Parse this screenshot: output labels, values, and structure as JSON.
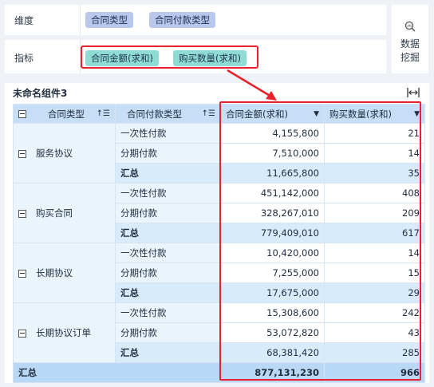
{
  "fields": {
    "dimension_label": "维度",
    "dimension_pills": [
      "合同类型",
      "合同付款类型"
    ],
    "measure_label": "指标",
    "measure_pills": [
      "合同金额(求和)",
      "购买数量(求和)"
    ]
  },
  "mining": {
    "line1": "数据",
    "line2": "挖掘",
    "icon": "search-chart-icon"
  },
  "widget": {
    "title": "未命名组件3",
    "columns": [
      "合同类型",
      "合同付款类型",
      "合同金额(求和)",
      "购买数量(求和)"
    ],
    "groups": [
      {
        "name": "服务协议",
        "rows": [
          {
            "type": "一次性付款",
            "amount": "4,155,800",
            "qty": "21"
          },
          {
            "type": "分期付款",
            "amount": "7,510,000",
            "qty": "14"
          },
          {
            "type": "汇总",
            "amount": "11,665,800",
            "qty": "35"
          }
        ]
      },
      {
        "name": "购买合同",
        "rows": [
          {
            "type": "一次性付款",
            "amount": "451,142,000",
            "qty": "408"
          },
          {
            "type": "分期付款",
            "amount": "328,267,010",
            "qty": "209"
          },
          {
            "type": "汇总",
            "amount": "779,409,010",
            "qty": "617"
          }
        ]
      },
      {
        "name": "长期协议",
        "rows": [
          {
            "type": "一次性付款",
            "amount": "10,420,000",
            "qty": "14"
          },
          {
            "type": "分期付款",
            "amount": "7,255,000",
            "qty": "15"
          },
          {
            "type": "汇总",
            "amount": "17,675,000",
            "qty": "29"
          }
        ]
      },
      {
        "name": "长期协议订单",
        "rows": [
          {
            "type": "一次性付款",
            "amount": "15,308,600",
            "qty": "242"
          },
          {
            "type": "分期付款",
            "amount": "53,072,820",
            "qty": "43"
          },
          {
            "type": "汇总",
            "amount": "68,381,420",
            "qty": "285"
          }
        ]
      }
    ],
    "grand_total": {
      "label": "汇总",
      "amount": "877,131,230",
      "qty": "966"
    }
  },
  "colors": {
    "highlight": "#e8232e",
    "dim_pill": "#b9c6ee",
    "measure_pill": "#8fdcd4",
    "header": "#c6def6"
  }
}
